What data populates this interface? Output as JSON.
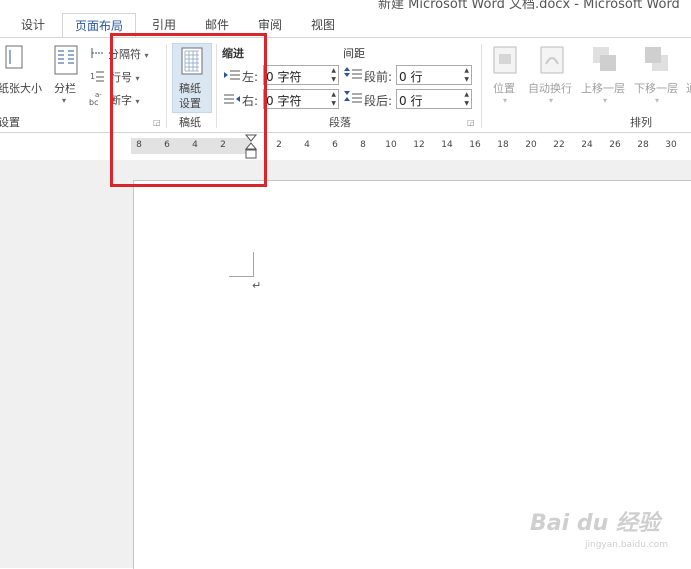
{
  "window": {
    "title": "新建 Microsoft Word 文档.docx - Microsoft Word"
  },
  "tabs": [
    {
      "label": "设计"
    },
    {
      "label": "页面布局",
      "active": true
    },
    {
      "label": "引用"
    },
    {
      "label": "邮件"
    },
    {
      "label": "审阅"
    },
    {
      "label": "视图"
    }
  ],
  "ribbon": {
    "page_setup": {
      "size_label": "纸张大小",
      "columns_label": "分栏",
      "breaks_label": "分隔符",
      "line_numbers_label": "行号",
      "hyphenation_label": "断字",
      "group_label": "设置"
    },
    "manuscript": {
      "button_label_line1": "稿纸",
      "button_label_line2": "设置",
      "group_label": "稿纸"
    },
    "paragraph": {
      "indent_header": "缩进",
      "spacing_header": "间距",
      "left_label": "左:",
      "right_label": "右:",
      "left_value": "0 字符",
      "right_value": "0 字符",
      "before_label": "段前:",
      "after_label": "段后:",
      "before_value": "0 行",
      "after_value": "0 行",
      "group_label": "段落"
    },
    "arrange": {
      "position_label": "位置",
      "wrap_label": "自动换行",
      "bring_forward_label": "上移一层",
      "send_backward_label": "下移一层",
      "group_label": "排列"
    }
  },
  "ruler": {
    "left_ticks": [
      "8",
      "6",
      "4",
      "2"
    ],
    "right_ticks": [
      "2",
      "4",
      "6",
      "8",
      "10",
      "12",
      "14",
      "16",
      "18",
      "20",
      "22",
      "24",
      "26",
      "28",
      "30"
    ]
  },
  "watermark": {
    "main": "Bai du 经验",
    "sub": "jingyan.baidu.com"
  },
  "colors": {
    "accent": "#2b579a",
    "highlight_box": "#d8262c",
    "selected_button": "#dbe6f3"
  }
}
